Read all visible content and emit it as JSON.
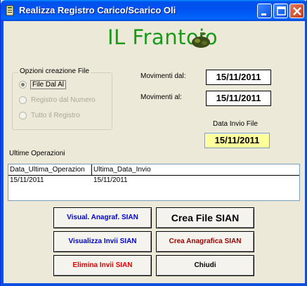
{
  "window": {
    "title": "Realizza Registro Carico/Scarico Oli"
  },
  "logo": {
    "text": "IL Frantoio"
  },
  "options": {
    "legend": "Opzioni creazione File",
    "items": [
      {
        "label": "File Dal Al",
        "selected": true,
        "enabled": true
      },
      {
        "label": "Registro dal Numero",
        "selected": false,
        "enabled": false
      },
      {
        "label": "Tutto il Registro",
        "selected": false,
        "enabled": false
      }
    ]
  },
  "dates": {
    "from_label": "Movimenti dal:",
    "from_value": "15/11/2011",
    "to_label": "Movimenti al:",
    "to_value": "15/11/2011",
    "invio_label": "Data Invio File",
    "invio_value": "15/11/2011"
  },
  "ultime": {
    "label": "Ultime Operazioni",
    "columns": [
      "Data_Ultima_Operazion",
      "Ultima_Data_Invio"
    ],
    "rows": [
      [
        "15/11/2011",
        "15/11/2011"
      ]
    ]
  },
  "buttons": {
    "visual_anagraf": {
      "label": "Visual. Anagraf. SIAN",
      "color": "#0000cc"
    },
    "crea_file": {
      "label": "Crea File SIAN",
      "color": "#000000"
    },
    "visualizza_invii": {
      "label": "Visualizza Invii SIAN",
      "color": "#0000cc"
    },
    "crea_anagrafica": {
      "label": "Crea Anagrafica SIAN",
      "color": "#990000"
    },
    "elimina_invii": {
      "label": "Elimina Invii SIAN",
      "color": "#e00000"
    },
    "chiudi": {
      "label": "Chiudi",
      "color": "#000000"
    }
  }
}
